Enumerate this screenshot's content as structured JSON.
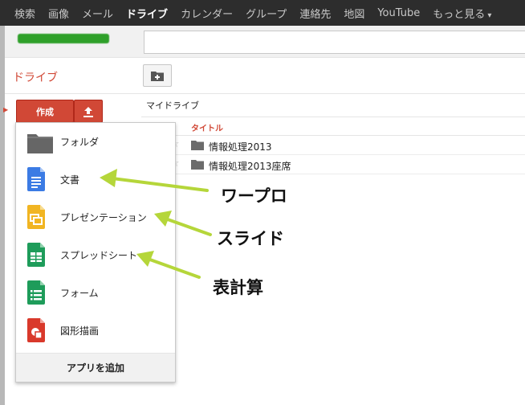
{
  "topbar": {
    "items": [
      {
        "label": "検索",
        "active": false
      },
      {
        "label": "画像",
        "active": false
      },
      {
        "label": "メール",
        "active": false
      },
      {
        "label": "ドライブ",
        "active": true
      },
      {
        "label": "カレンダー",
        "active": false
      },
      {
        "label": "グループ",
        "active": false
      },
      {
        "label": "連絡先",
        "active": false
      },
      {
        "label": "地図",
        "active": false
      },
      {
        "label": "YouTube",
        "active": false
      },
      {
        "label": "もっと見る",
        "active": false
      }
    ]
  },
  "header": {
    "search": {
      "value": "",
      "placeholder": ""
    }
  },
  "sidebar": {
    "title": "ドライブ",
    "create_label": "作成",
    "upload_icon": "upload-icon"
  },
  "toolbar": {
    "new_folder_icon": "new-folder-icon"
  },
  "main": {
    "breadcrumb": "マイドライブ",
    "columns": {
      "title": "タイトル"
    },
    "rows": [
      {
        "name": "情報処理2013",
        "icon": "folder-icon"
      },
      {
        "name": "情報処理2013座席",
        "icon": "folder-icon"
      }
    ]
  },
  "create_menu": {
    "items": [
      {
        "label": "フォルダ",
        "icon": "folder-icon"
      },
      {
        "label": "文書",
        "icon": "docs-icon"
      },
      {
        "label": "プレゼンテーション",
        "icon": "slides-icon"
      },
      {
        "label": "スプレッドシート",
        "icon": "sheets-icon"
      },
      {
        "label": "フォーム",
        "icon": "forms-icon"
      },
      {
        "label": "図形描画",
        "icon": "drawing-icon"
      }
    ],
    "footer": "アプリを追加"
  },
  "annotations": {
    "docs": "ワープロ",
    "slides": "スライド",
    "sheets": "表計算",
    "arrow_color": "#b5d63a"
  },
  "colors": {
    "accent_red": "#d14836",
    "docs_blue": "#3b7be4",
    "slides_yellow": "#f1b522",
    "sheets_green": "#1e9c5a",
    "forms_green": "#1e9c5a",
    "drawing_red": "#d9392b"
  }
}
